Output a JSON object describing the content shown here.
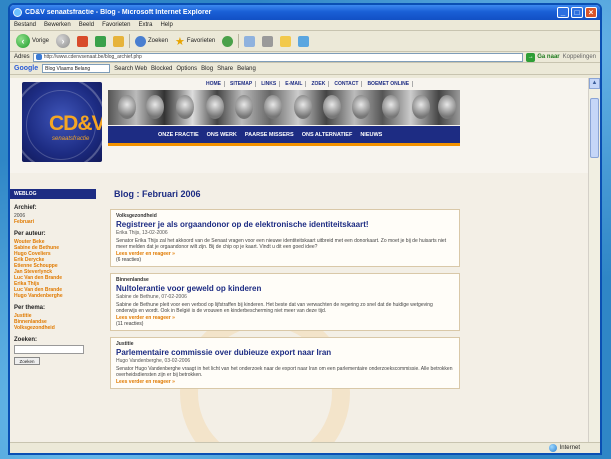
{
  "window": {
    "title": "CD&V senaatsfractie - Blog - Microsoft Internet Explorer"
  },
  "menu": [
    "Bestand",
    "Bewerken",
    "Beeld",
    "Favorieten",
    "Extra",
    "Help"
  ],
  "toolbar": {
    "back": "Vorige",
    "search": "Zoeken",
    "favorites": "Favorieten"
  },
  "address": {
    "label": "Adres",
    "url": "http://www.cdenvsenaat.be/blog_archief.php",
    "go": "Ga naar",
    "links": "Koppelingen"
  },
  "googlebar": {
    "logo": "Google",
    "select": "Blog Vlaams Belang",
    "search_web": "Search Web",
    "blocked": "Blocked",
    "options": "Options",
    "blog": "Blog",
    "share": "Share",
    "blog2": "Belang"
  },
  "site": {
    "topnav": [
      "HOME",
      "SITEMAP",
      "LINKS",
      "E-MAIL",
      "ZOEK",
      "CONTACT",
      "BOEMET ONLINE"
    ],
    "mainnav": [
      "ONZE FRACTIE",
      "ONS WERK",
      "PAARSE MISSERS",
      "ONS ALTERNATIEF",
      "NIEUWS"
    ],
    "logo_text": "CD&V",
    "logo_sub": "senaatsfractie"
  },
  "sidebar": {
    "head": "WEBLOG",
    "archive_title": "Archief:",
    "archive_year": "2006",
    "archive_month": "Februari",
    "authors_title": "Per auteur:",
    "authors": [
      "Wouter Beke",
      "Sabine de Bethune",
      "Hugo Coveliers",
      "Erik Derycke",
      "Etienne Schouppe",
      "Jan Steverlynck",
      "Luc Van den Brande",
      "Erika Thijs",
      "Luc Van den Brande",
      "Hugo Vandenberghe"
    ],
    "themes_title": "Per thema:",
    "themes": [
      "Justitie",
      "Binnenlandse",
      "Volksgezondheid"
    ],
    "search_title": "Zoeken:",
    "search_btn": "Zoeken"
  },
  "blog": {
    "title": "Blog : Februari 2006",
    "posts": [
      {
        "cat": "Volksgezondheid",
        "title": "Registreer je als orgaandonor op de elektronische identiteitskaart!",
        "byline": "Erika Thijs, 13-02-2006",
        "body": "Senator Erika Thijs zal het akkoord van de Senaat vragen voor een nieuwe identiteitskaart uitbreid met een donorkaart. Zo moet je bij de huisarts niet meer melden dat je orgaandonor wilt zijn. Bij de chip op je kaart. Vindt u dit een goed idee?",
        "more": "Lees verder en reageer »",
        "reacties": "(6 reacties)"
      },
      {
        "cat": "Binnenlandse",
        "title": "Nultolerantie voor geweld op kinderen",
        "byline": "Sabine de Bethune, 07-02-2006",
        "body": "Sabine de Bethune pleit voor een verbod op lijfstraffen bij kinderen. Het beste dat van verwachten de regering zo snel dat de huidige wetgeving onderwijs en wordt. Ook in België is de vrouwen en kinderbescherming niet meer van deze tijd.",
        "more": "Lees verder en reageer »",
        "reacties": "(11 reacties)"
      },
      {
        "cat": "Justitie",
        "title": "Parlementaire commissie over dubieuze export naar Iran",
        "byline": "Hugo Vandenberghe, 03-02-2006",
        "body": "Senator Hugo Vandenberghe vraagt in het licht van het onderzoek naar de export naar Iran om een parlementaire onderzoekscommissie. Alle betrokken overheidsdiensten zijn er bij betrokken.",
        "more": "Lees verder en reageer »",
        "reacties": ""
      }
    ]
  },
  "status": {
    "zone": "Internet"
  },
  "colors": {
    "navy": "#1d2c83",
    "orange": "#f39200",
    "xp_blue": "#1a5fd6"
  }
}
